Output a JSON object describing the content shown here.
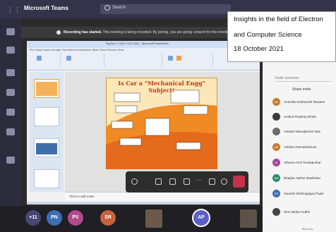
{
  "app": {
    "title": "Microsoft Teams",
    "search_placeholder": "Search"
  },
  "banner": {
    "bold": "Recording has started.",
    "text": "This meeting is being recorded. By joining, you are giving consent for this meeting"
  },
  "overlay": {
    "line1": "Insights in the field of Electron",
    "line2": "and Computer Science",
    "line3": "18 October 2021"
  },
  "shared_window": {
    "app_title": "Sig Rec 1 2021 YOG 2021 - Microsoft PowerPoint",
    "ribbon_tabs": "File   Home   Insert   Design   Transitions   Animations   Slide Show   Review   View",
    "slide_title": "Is Car a \"Mechanical Engg\" Subject!",
    "notes_placeholder": "Click to add notes"
  },
  "panel": {
    "search_placeholder": "Invite someone",
    "share_invite": "Share invite",
    "more_label": "More (2)",
    "participants": [
      {
        "initials": "AH",
        "name": "Anamika Dasharath Rawase",
        "color": "#c77b2e"
      },
      {
        "initials": "AP",
        "name": "Anshul Pradeep Dhole",
        "color": "#3a3a3a"
      },
      {
        "initials": "AM",
        "name": "Ashwini Manojkumar Nair",
        "color": "#5b5b5b"
      },
      {
        "initials": "AR",
        "name": "Ashwini Ramakrishnan",
        "color": "#c77b2e"
      },
      {
        "initials": "AT",
        "name": "Atharva Amit Tondapurkar",
        "color": "#a2489c"
      },
      {
        "initials": "BM",
        "name": "Bhajdev Mehul Madhukar",
        "color": "#2e8a6b"
      },
      {
        "initials": "GP",
        "name": "Ganesh Shivlingappa Pujari",
        "color": "#3b6fb6"
      },
      {
        "initials": "HS",
        "name": "Hira Sarika Sudhir",
        "color": "#444444"
      }
    ]
  },
  "strip": {
    "avatars": [
      {
        "label": "+11",
        "color": "#464775"
      },
      {
        "label": "PN",
        "color": "#3b6fb6"
      },
      {
        "label": "PV",
        "color": "#b24a8f"
      },
      {
        "label": "SR",
        "color": "#c7613e"
      },
      {
        "label": "AP",
        "color": "#5b5fc7"
      }
    ]
  },
  "icons": {
    "rail": [
      "activity-icon",
      "chat-icon",
      "teams-icon",
      "calendar-icon",
      "calls-icon",
      "files-icon",
      "more-icon"
    ],
    "controls": [
      "timer-icon",
      "camera-icon",
      "mic-icon",
      "share-icon",
      "more-icon",
      "chat-icon",
      "people-icon",
      "hangup-icon"
    ]
  }
}
